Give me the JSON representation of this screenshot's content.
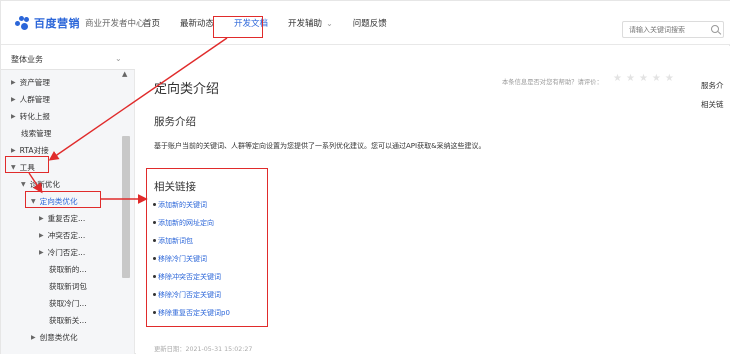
{
  "header": {
    "logo_text": "百度营销",
    "logo_sub": "商业开发者中心",
    "nav": [
      {
        "label": "首页"
      },
      {
        "label": "最新动态"
      },
      {
        "label": "开发文档"
      },
      {
        "label": "开发辅助"
      },
      {
        "label": "问题反馈"
      }
    ],
    "search_placeholder": "请输入关键词搜索"
  },
  "sidebar": {
    "header": "整体业务",
    "items": [
      {
        "label": "资产管理"
      },
      {
        "label": "人群管理"
      },
      {
        "label": "转化上报"
      },
      {
        "label": "线索管理"
      },
      {
        "label": "RTA对接"
      },
      {
        "label": "工具"
      },
      {
        "label": "诊断优化"
      },
      {
        "label": "定向类优化"
      },
      {
        "label": "重复否定..."
      },
      {
        "label": "冲突否定..."
      },
      {
        "label": "冷门否定..."
      },
      {
        "label": "获取新的..."
      },
      {
        "label": "获取新词包"
      },
      {
        "label": "获取冷门..."
      },
      {
        "label": "获取新关..."
      },
      {
        "label": "创意类优化"
      }
    ]
  },
  "main": {
    "page_title": "定向类介绍",
    "feedback_text": "本条信息是否对您有帮助？请评价：",
    "rating": 0,
    "right_nav": [
      "服务介",
      "相关链"
    ],
    "section_title": "服务介绍",
    "section_desc": "基于账户当前的关键词、人群等定向设置为您提供了一系列优化建议。您可以通过API获取&采纳这些建议。",
    "links_title": "相关链接",
    "links": [
      "添加新的关键词",
      "添加新的网址定向",
      "添加新词包",
      "移除冷门关键词",
      "移除冲突否定关键词",
      "移除冷门否定关键词",
      "移除重复否定关键词p0"
    ],
    "update_time": "更新日期：2021-05-31 15:02:27"
  },
  "colors": {
    "accent": "#2b66d9",
    "annotation": "#e02b2b"
  }
}
